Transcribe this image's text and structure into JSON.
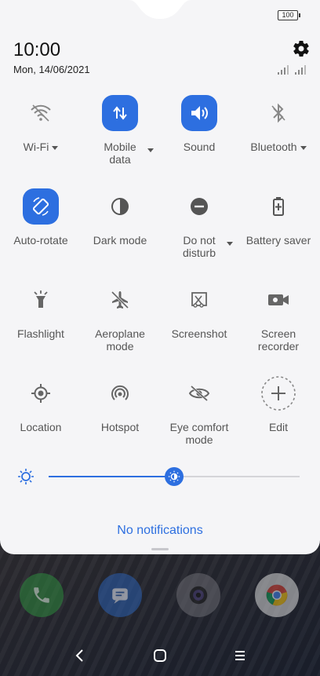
{
  "status": {
    "battery": "100",
    "time": "10:00",
    "date": "Mon, 14/06/2021"
  },
  "tiles": [
    {
      "name": "tile-wifi",
      "label": "Wi-Fi",
      "icon": "wifi-icon",
      "active": false,
      "dropdown": true
    },
    {
      "name": "tile-mobile-data",
      "label": "Mobile data",
      "icon": "mobile-data-icon",
      "active": true,
      "dropdown": true
    },
    {
      "name": "tile-sound",
      "label": "Sound",
      "icon": "sound-icon",
      "active": true,
      "dropdown": false
    },
    {
      "name": "tile-bluetooth",
      "label": "Bluetooth",
      "icon": "bluetooth-icon",
      "active": false,
      "dropdown": true
    },
    {
      "name": "tile-auto-rotate",
      "label": "Auto-rotate",
      "icon": "auto-rotate-icon",
      "active": true,
      "dropdown": false
    },
    {
      "name": "tile-dark-mode",
      "label": "Dark mode",
      "icon": "dark-mode-icon",
      "active": false,
      "dropdown": false
    },
    {
      "name": "tile-do-not-disturb",
      "label": "Do not disturb",
      "icon": "do-not-disturb-icon",
      "active": false,
      "dropdown": true
    },
    {
      "name": "tile-battery-saver",
      "label": "Battery saver",
      "icon": "battery-saver-icon",
      "active": false,
      "dropdown": false
    },
    {
      "name": "tile-flashlight",
      "label": "Flashlight",
      "icon": "flashlight-icon",
      "active": false,
      "dropdown": false
    },
    {
      "name": "tile-aeroplane-mode",
      "label": "Aeroplane mode",
      "icon": "aeroplane-icon",
      "active": false,
      "dropdown": false
    },
    {
      "name": "tile-screenshot",
      "label": "Screenshot",
      "icon": "screenshot-icon",
      "active": false,
      "dropdown": false
    },
    {
      "name": "tile-screen-recorder",
      "label": "Screen recorder",
      "icon": "screen-recorder-icon",
      "active": false,
      "dropdown": false
    },
    {
      "name": "tile-location",
      "label": "Location",
      "icon": "location-icon",
      "active": false,
      "dropdown": false
    },
    {
      "name": "tile-hotspot",
      "label": "Hotspot",
      "icon": "hotspot-icon",
      "active": false,
      "dropdown": false
    },
    {
      "name": "tile-eye-comfort",
      "label": "Eye comfort mode",
      "icon": "eye-comfort-icon",
      "active": false,
      "dropdown": false
    },
    {
      "name": "tile-edit",
      "label": "Edit",
      "icon": "add-icon",
      "active": false,
      "dropdown": false
    }
  ],
  "tile_labels": {
    "wifi": "Wi-Fi",
    "mobile_data_1": "Mobile",
    "mobile_data_2": "data",
    "sound": "Sound",
    "bluetooth": "Bluetooth",
    "auto_rotate": "Auto-rotate",
    "dark_mode": "Dark mode",
    "dnd_1": "Do not",
    "dnd_2": "disturb",
    "battery_saver": "Battery saver",
    "flashlight": "Flashlight",
    "aeroplane_1": "Aeroplane",
    "aeroplane_2": "mode",
    "screenshot": "Screenshot",
    "recorder_1": "Screen",
    "recorder_2": "recorder",
    "location": "Location",
    "hotspot": "Hotspot",
    "eye_1": "Eye comfort",
    "eye_2": "mode",
    "edit": "Edit"
  },
  "brightness": {
    "level_percent": 50
  },
  "notifications": {
    "empty_text": "No notifications"
  },
  "colors": {
    "accent": "#2d6fe0",
    "panel": "#f5f5f7",
    "icon_inactive": "#666666"
  },
  "dock": [
    "phone-app-icon",
    "messages-app-icon",
    "camera-app-icon",
    "chrome-app-icon"
  ],
  "navbar": [
    "back-icon",
    "home-icon",
    "recents-icon"
  ]
}
